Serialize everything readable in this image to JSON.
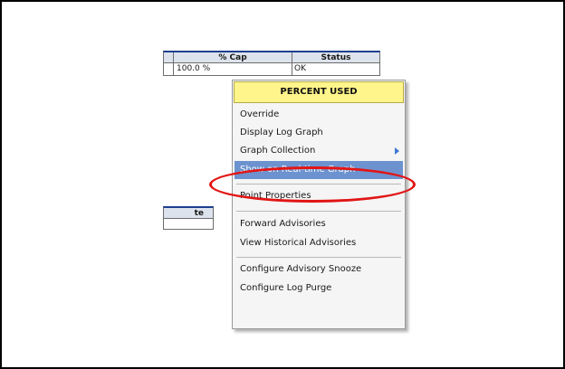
{
  "table": {
    "headers": [
      "% Cap",
      "Status"
    ],
    "row": {
      "percent_cap": "100.0 %",
      "status": "OK"
    }
  },
  "lower_table": {
    "header": "te"
  },
  "context_menu": {
    "title": "PERCENT USED",
    "items": [
      {
        "label": "Override"
      },
      {
        "label": "Display Log Graph"
      },
      {
        "label": "Graph Collection",
        "has_submenu": true
      },
      {
        "label": "Show on Real-time Graph",
        "highlighted": true
      },
      {
        "label": "Point Properties"
      },
      {
        "label": "Forward Advisories"
      },
      {
        "label": "View Historical Advisories"
      },
      {
        "label": "Configure Advisory Snooze"
      },
      {
        "label": "Configure Log Purge"
      }
    ],
    "highlight_color": "#6c93cf",
    "title_color": "#fff58a"
  },
  "annotation": {
    "color": "#e21515",
    "shape": "ellipse"
  }
}
